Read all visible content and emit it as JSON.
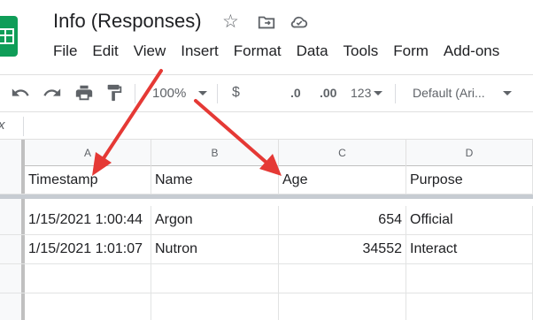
{
  "document": {
    "title": "Info (Responses)",
    "icons": [
      "star-icon",
      "move-to-folder-icon",
      "cloud-status-icon"
    ]
  },
  "menu": {
    "items": [
      "File",
      "Edit",
      "View",
      "Insert",
      "Format",
      "Data",
      "Tools",
      "Form",
      "Add-ons"
    ]
  },
  "toolbar": {
    "zoom": "100%",
    "currency": "$",
    "decrease_decimal": ".0",
    "increase_decimal": ".00",
    "more_formats": "123",
    "font": "Default (Ari..."
  },
  "sheet": {
    "columns": [
      "A",
      "B",
      "C",
      "D"
    ],
    "header_row": [
      "Timestamp",
      "Name",
      "Age",
      "Purpose"
    ],
    "rows": [
      [
        "1/15/2021 1:00:44",
        "Argon",
        "654",
        "Official"
      ],
      [
        "1/15/2021 1:01:07",
        "Nutron",
        "34552",
        "Interact"
      ]
    ]
  },
  "annotation_color": "#e53935"
}
